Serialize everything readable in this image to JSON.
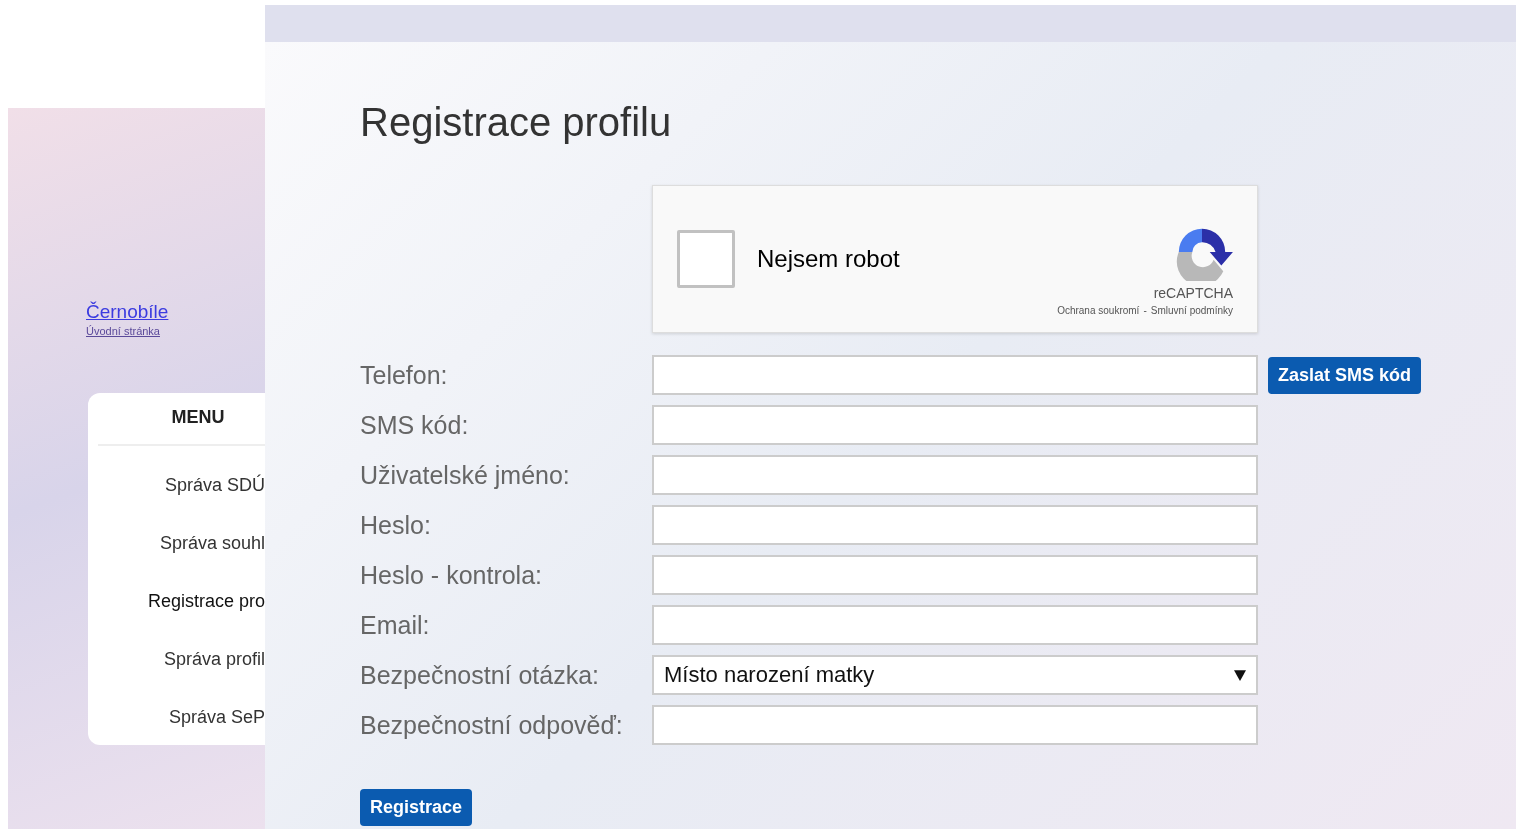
{
  "sidebar": {
    "site_link": "Černobíle",
    "home_link": "Úvodní stránka",
    "menu": {
      "title": "MENU",
      "items": [
        {
          "label": "Správa SDÚ",
          "selected": false
        },
        {
          "label": "Správa souhl",
          "selected": false
        },
        {
          "label": "Registrace pro",
          "selected": true
        },
        {
          "label": "Správa profil",
          "selected": false
        },
        {
          "label": "Správa SeP",
          "selected": false
        }
      ]
    }
  },
  "page": {
    "title": "Registrace profilu",
    "captcha": {
      "label": "Nejsem robot",
      "checked": false,
      "brand": "reCAPTCHA",
      "privacy": "Ochrana soukromí",
      "separator": "-",
      "terms": "Smluvní podmínky"
    },
    "fields": [
      {
        "label": "Telefon:",
        "kind": "text",
        "action": "Zaslat SMS kód"
      },
      {
        "label": "SMS kód:",
        "kind": "text"
      },
      {
        "label": "Uživatelské jméno:",
        "kind": "text"
      },
      {
        "label": "Heslo:",
        "kind": "password"
      },
      {
        "label": "Heslo - kontrola:",
        "kind": "password"
      },
      {
        "label": "Email:",
        "kind": "text"
      },
      {
        "label": "Bezpečnostní otázka:",
        "kind": "select",
        "value": "Místo narození matky"
      },
      {
        "label": "Bezpečnostní odpověď:",
        "kind": "text"
      }
    ],
    "submit": "Registrace"
  }
}
